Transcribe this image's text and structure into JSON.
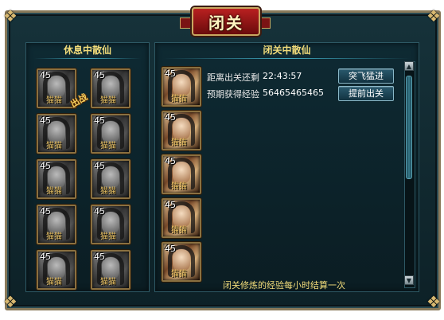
{
  "title": "闭关",
  "left_panel": {
    "header": "休息中散仙",
    "deploy_label": "出战",
    "slots": [
      {
        "level": "45",
        "tag": "猫猫"
      },
      {
        "level": "45",
        "tag": "猫猫"
      },
      {
        "level": "45",
        "tag": "猫猫"
      },
      {
        "level": "45",
        "tag": "猫猫"
      },
      {
        "level": "45",
        "tag": "猫猫"
      },
      {
        "level": "45",
        "tag": "猫猫"
      },
      {
        "level": "45",
        "tag": "猫猫"
      },
      {
        "level": "45",
        "tag": "猫猫"
      },
      {
        "level": "45",
        "tag": "猫猫"
      },
      {
        "level": "45",
        "tag": "猫猫"
      }
    ]
  },
  "right_panel": {
    "header": "闭关中散仙",
    "remaining_label": "距离出关还剩",
    "remaining_value": "22:43:57",
    "exp_label": "预期获得经验",
    "exp_value": "56465465465",
    "breakthrough_button": "突飞猛进",
    "early_exit_button": "提前出关",
    "slots": [
      {
        "level": "45",
        "tag": "猫猫"
      },
      {
        "level": "45",
        "tag": "猫猫"
      },
      {
        "level": "45",
        "tag": "猫猫"
      },
      {
        "level": "45",
        "tag": "猫猫"
      },
      {
        "level": "45",
        "tag": "猫猫"
      }
    ],
    "footer_note": "闭关修炼的经验每小时结算一次"
  },
  "colors": {
    "frame_border": "#8a7a5a",
    "header_text": "#f2dc7a",
    "title_bg": "#b82020"
  }
}
